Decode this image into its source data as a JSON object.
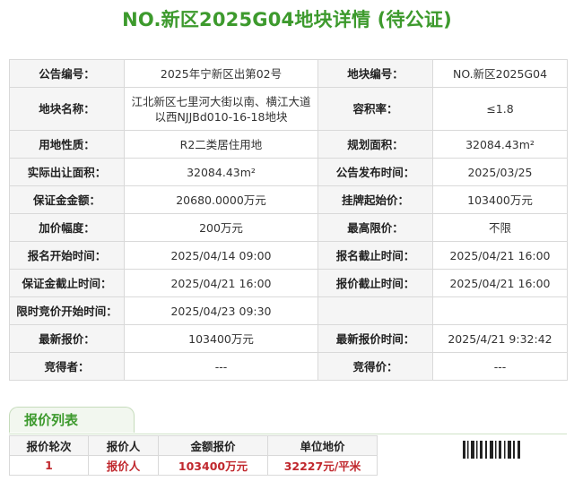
{
  "title": "NO.新区2025G04地块详情 (待公证)",
  "colors": {
    "accent_green": "#3d9a2d",
    "price_red": "#b5383a",
    "bid_red": "#c0272d"
  },
  "info_rows": [
    {
      "l1": "公告编号：",
      "v1": "2025年宁新区出第02号",
      "l2": "地块编号：",
      "v2": "NO.新区2025G04"
    },
    {
      "l1": "地块名称：",
      "v1": "江北新区七里河大街以南、横江大道以西NJJBd010-16-18地块",
      "l2": "容积率：",
      "v2": "≤1.8"
    },
    {
      "l1": "用地性质：",
      "v1": "R2二类居住用地",
      "l2": "规划面积：",
      "v2": "32084.43m²"
    },
    {
      "l1": "实际出让面积：",
      "v1": "32084.43m²",
      "l2": "公告发布时间：",
      "v2": "2025/03/25"
    },
    {
      "l1": "保证金金额：",
      "v1": "20680.0000万元",
      "l2": "挂牌起始价：",
      "v2": "103400万元"
    },
    {
      "l1": "加价幅度：",
      "v1": "200万元",
      "l2": "最高限价：",
      "v2": "不限"
    },
    {
      "l1": "报名开始时间：",
      "v1": "2025/04/14 09:00",
      "l2": "报名截止时间：",
      "v2": "2025/04/21 16:00"
    },
    {
      "l1": "保证金截止时间：",
      "v1": "2025/04/21 16:00",
      "l2": "报价截止时间：",
      "v2": "2025/04/21 16:00"
    },
    {
      "l1": "限时竞价开始时间：",
      "v1": "2025/04/23 09:30",
      "l2": "",
      "v2": ""
    },
    {
      "l1": "最新报价：",
      "v1": "103400万元",
      "l2": "最新报价时间：",
      "v2": "2025/4/21 9:32:42"
    },
    {
      "l1": "竞得者：",
      "v1": "---",
      "l2": "竞得价：",
      "v2": "---"
    }
  ],
  "bid_section": {
    "tab_label": "报价列表",
    "headers": [
      "报价轮次",
      "报价人",
      "金额报价",
      "单位地价"
    ],
    "rows": [
      [
        "1",
        "报价人",
        "103400万元",
        "32227元/平米"
      ]
    ]
  }
}
